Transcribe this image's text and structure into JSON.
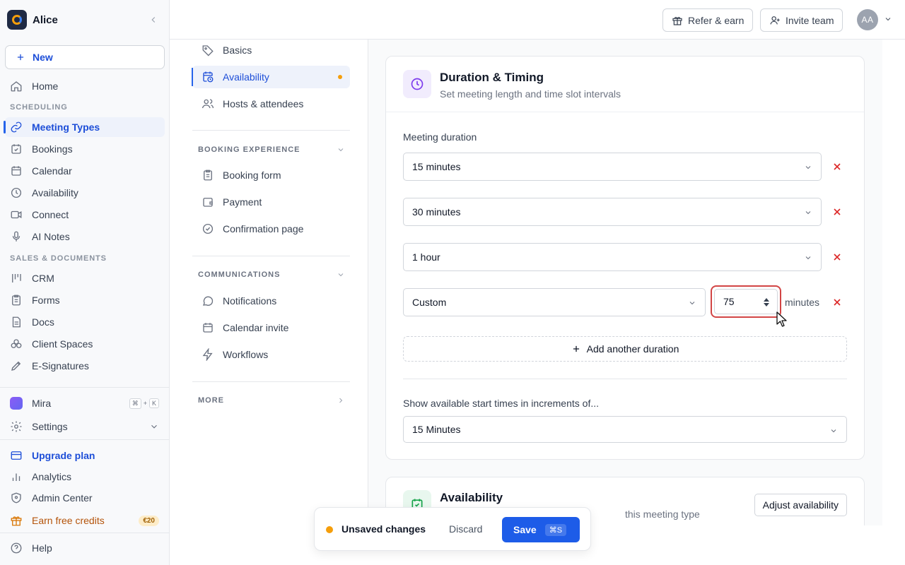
{
  "workspace": {
    "name": "Alice"
  },
  "sidebar": {
    "new_label": "New",
    "home": "Home",
    "scheduling_label": "SCHEDULING",
    "scheduling_items": [
      {
        "label": "Meeting Types",
        "icon": "link-icon"
      },
      {
        "label": "Bookings",
        "icon": "calendar-check-icon"
      },
      {
        "label": "Calendar",
        "icon": "calendar-icon"
      },
      {
        "label": "Availability",
        "icon": "clock-icon"
      },
      {
        "label": "Connect",
        "icon": "video-icon"
      },
      {
        "label": "AI Notes",
        "icon": "mic-icon"
      }
    ],
    "sales_label": "SALES & DOCUMENTS",
    "sales_items": [
      {
        "label": "CRM",
        "icon": "crm-icon"
      },
      {
        "label": "Forms",
        "icon": "clipboard-icon"
      },
      {
        "label": "Docs",
        "icon": "doc-icon"
      },
      {
        "label": "Client Spaces",
        "icon": "spaces-icon"
      },
      {
        "label": "E-Signatures",
        "icon": "pen-icon"
      }
    ],
    "mira": {
      "label": "Mira",
      "shortcut_cmd": "⌘",
      "shortcut_plus": "+",
      "shortcut_key": "K"
    },
    "settings": "Settings",
    "upgrade": "Upgrade plan",
    "analytics": "Analytics",
    "admin": "Admin Center",
    "earn": "Earn free credits",
    "earn_badge": "€20",
    "help": "Help"
  },
  "topbar": {
    "refer": "Refer & earn",
    "invite": "Invite team",
    "avatar": "AA"
  },
  "subnav": {
    "items_top": [
      {
        "label": "Basics"
      },
      {
        "label": "Availability"
      },
      {
        "label": "Hosts & attendees"
      }
    ],
    "booking_label": "BOOKING EXPERIENCE",
    "booking_items": [
      {
        "label": "Booking form"
      },
      {
        "label": "Payment"
      },
      {
        "label": "Confirmation page"
      }
    ],
    "comm_label": "COMMUNICATIONS",
    "comm_items": [
      {
        "label": "Notifications"
      },
      {
        "label": "Calendar invite"
      },
      {
        "label": "Workflows"
      }
    ],
    "more_label": "MORE"
  },
  "duration_card": {
    "title": "Duration & Timing",
    "subtitle": "Set meeting length and time slot intervals",
    "duration_label": "Meeting duration",
    "durations": [
      "15 minutes",
      "30 minutes",
      "1 hour",
      "Custom"
    ],
    "custom_value": "75",
    "custom_unit": "minutes",
    "add_label": "Add another duration",
    "increment_label": "Show available start times in increments of...",
    "increment_value": "15 Minutes"
  },
  "availability_card": {
    "title": "Availability",
    "subtitle_visible": "this meeting type",
    "adjust": "Adjust availability"
  },
  "unsaved_bar": {
    "message": "Unsaved changes",
    "discard": "Discard",
    "save": "Save",
    "save_shortcut": "⌘S"
  },
  "colors": {
    "accent": "#1d5ce8",
    "active_nav": "#1d4ed8",
    "danger": "#dc2626",
    "warning": "#f59e0b",
    "earn": "#b45309"
  }
}
